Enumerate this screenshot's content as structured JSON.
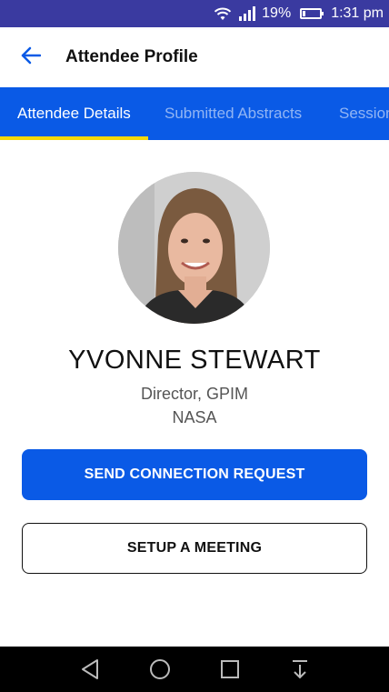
{
  "status_bar": {
    "battery_percent": "19%",
    "battery_level": 0.19,
    "time": "1:31 pm",
    "icons": [
      "wifi-icon",
      "signal-icon",
      "battery-icon"
    ]
  },
  "app_bar": {
    "title": "Attendee Profile",
    "back_icon": "arrow-left-icon"
  },
  "tabs": {
    "items": [
      {
        "label": "Attendee Details",
        "active": true
      },
      {
        "label": "Submitted Abstracts",
        "active": false
      },
      {
        "label": "Sessions",
        "active": false
      }
    ]
  },
  "profile": {
    "name": "YVONNE STEWART",
    "role": "Director, GPIM",
    "organization": "NASA"
  },
  "actions": {
    "connect_label": "SEND CONNECTION REQUEST",
    "meeting_label": "SETUP A MEETING"
  },
  "colors": {
    "primary": "#0a5ae6",
    "tab_indicator": "#f5d90a",
    "status_bar": "#3a3aa0"
  },
  "nav_bar": {
    "icons": [
      "back-triangle-icon",
      "home-circle-icon",
      "recents-square-icon",
      "notification-pull-icon"
    ]
  }
}
